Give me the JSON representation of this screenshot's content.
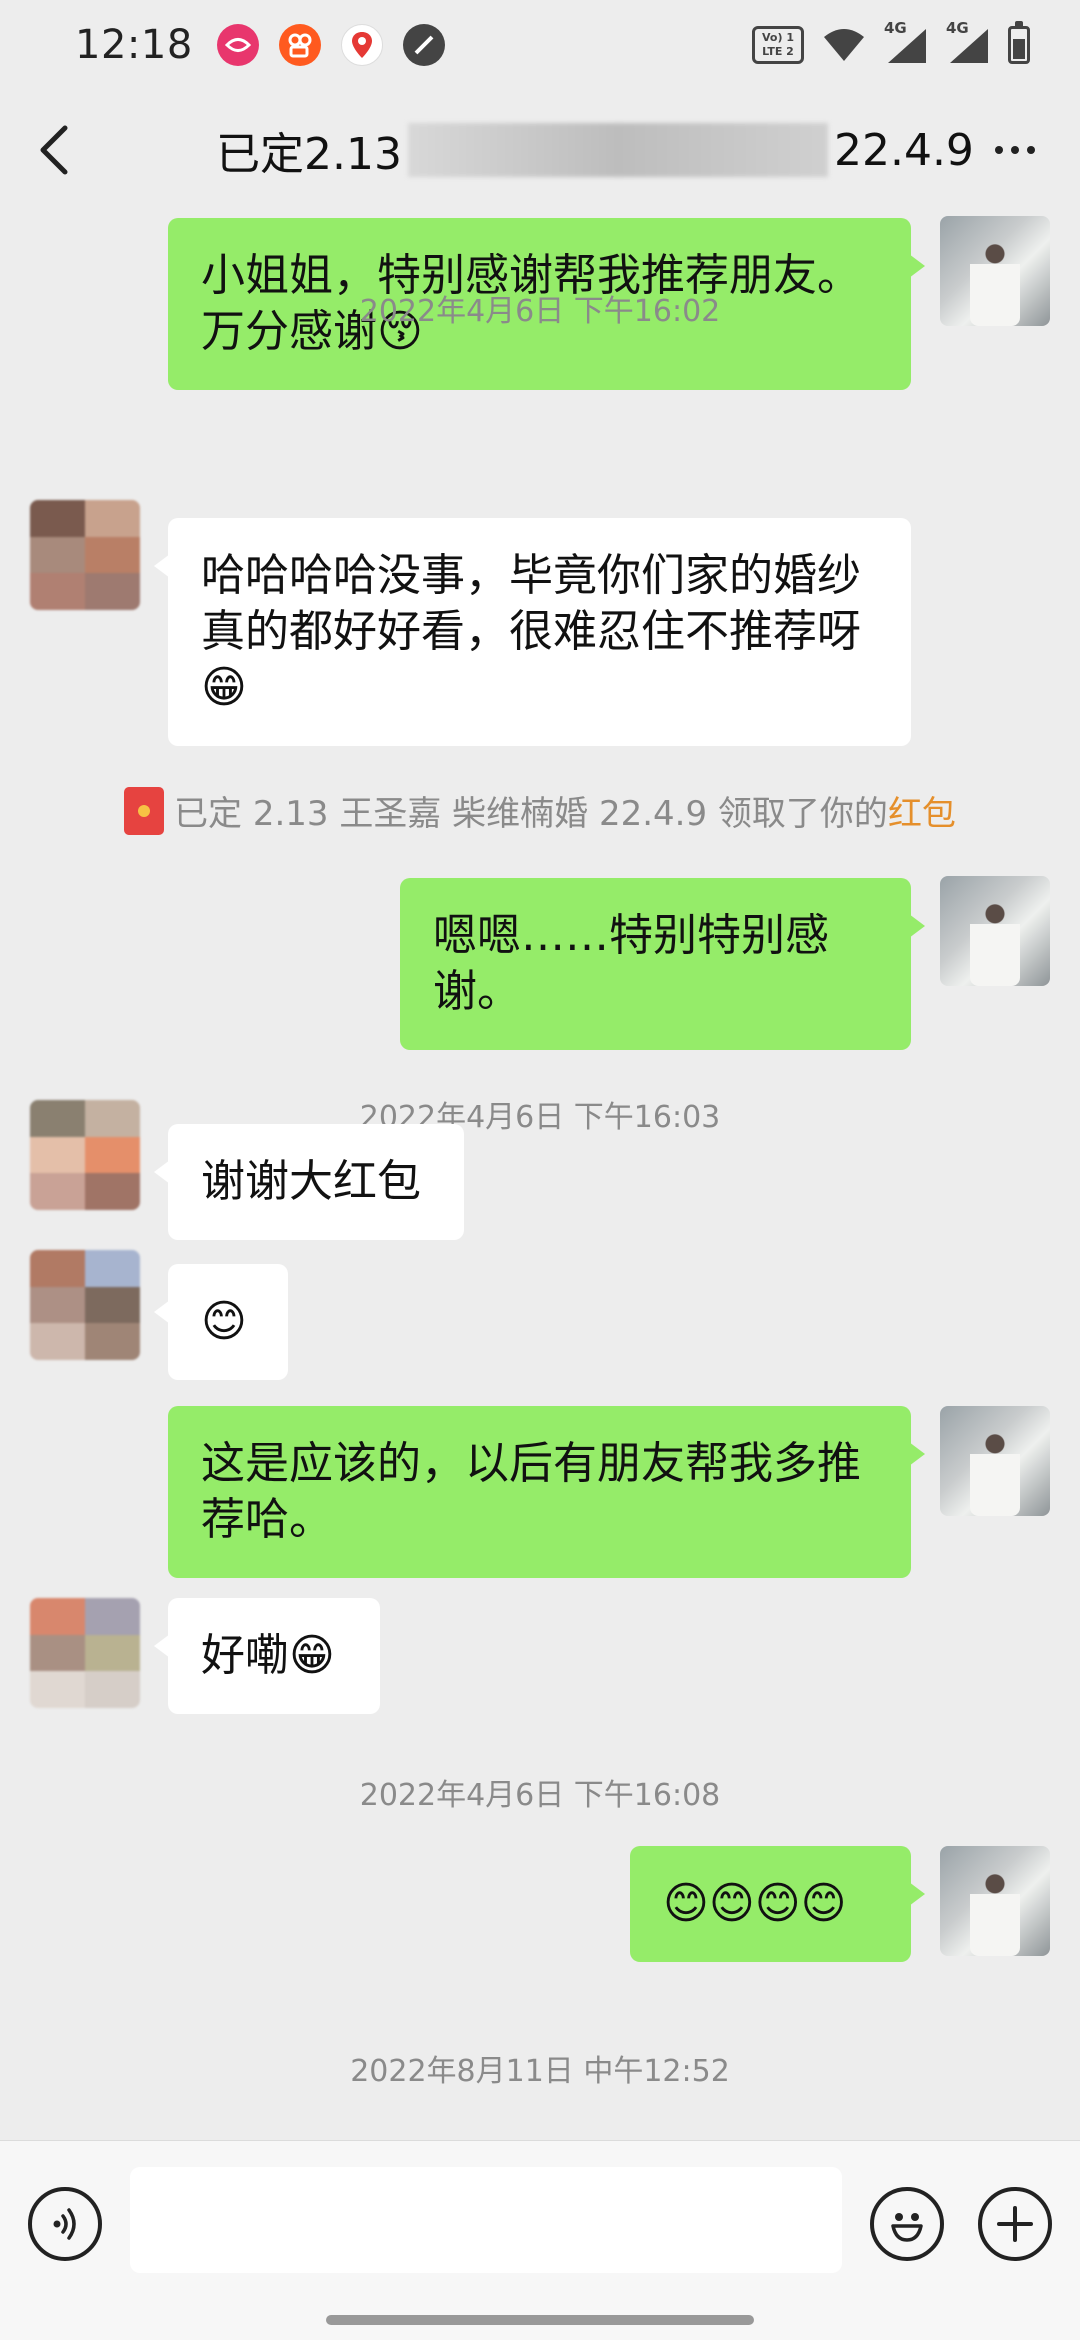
{
  "status_bar": {
    "time": "12:18",
    "volte_line1": "Vo) 1",
    "volte_line2": "LTE 2",
    "net1": "4G",
    "net2": "4G"
  },
  "header": {
    "title_start": "已定2.13",
    "title_end": "22.4.9",
    "more_icon": "more-dots-icon",
    "back_icon": "chevron-left-icon"
  },
  "messages": [
    {
      "side": "me",
      "text": "小姐姐，特别感谢帮我推荐朋友。万分感谢😚"
    },
    {
      "type": "time",
      "text": "2022年4月6日 下午16:02"
    },
    {
      "side": "them",
      "text": "哈哈哈哈没事，毕竟你们家的婚纱真的都好好看，很难忍住不推荐呀😁"
    },
    {
      "type": "system",
      "text": "已定 2.13 王圣嘉 柴维楠婚 22.4.9 领取了你的",
      "link": "红包"
    },
    {
      "side": "me",
      "text": "嗯嗯……特别特别感谢。"
    },
    {
      "type": "time",
      "text": "2022年4月6日 下午16:03"
    },
    {
      "side": "them",
      "text": "谢谢大红包"
    },
    {
      "side": "them",
      "text": "😊"
    },
    {
      "side": "me",
      "text": "这是应该的，以后有朋友帮我多推荐哈。"
    },
    {
      "side": "them",
      "text": "好嘞😁"
    },
    {
      "type": "time",
      "text": "2022年4月6日 下午16:08"
    },
    {
      "side": "me",
      "text": "😊😊😊😊"
    },
    {
      "type": "time",
      "text": "2022年8月11日 中午12:52"
    }
  ],
  "input_bar": {
    "voice_icon": "voice-icon",
    "emoji_icon": "emoji-icon",
    "plus_icon": "plus-icon",
    "placeholder": ""
  },
  "colors": {
    "me_bubble": "#95ec69",
    "them_bubble": "#ffffff",
    "background": "#ededed",
    "link": "#e58f2b",
    "red_packet": "#e64340"
  }
}
